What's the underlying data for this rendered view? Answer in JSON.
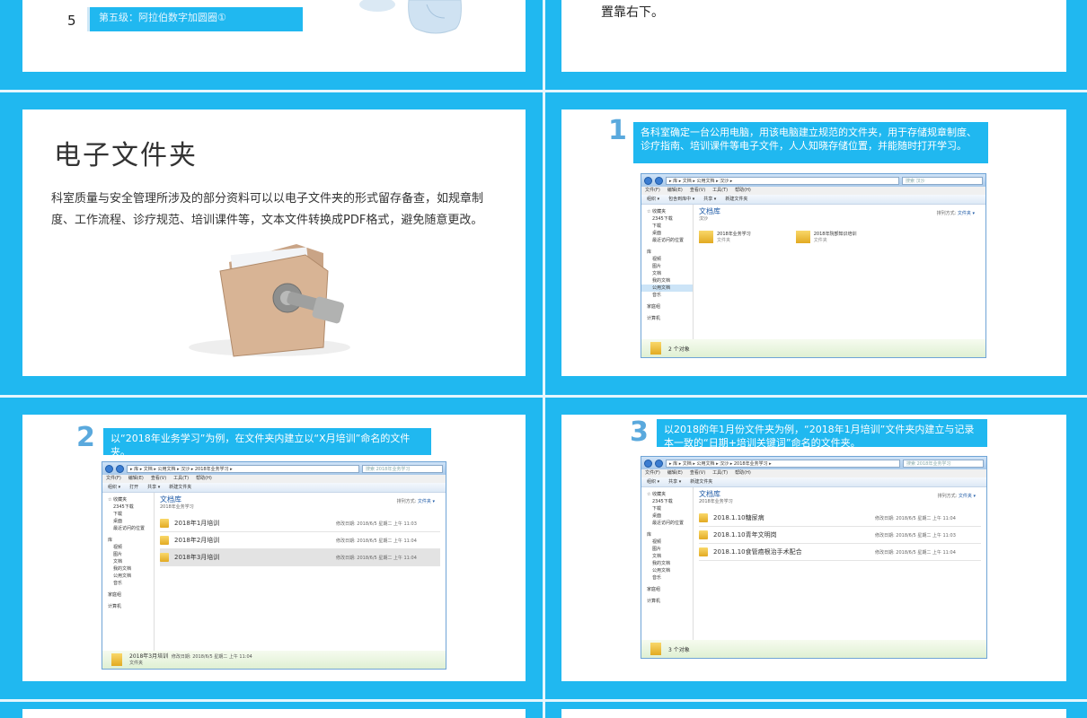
{
  "top_left": {
    "number": "5",
    "bar_text": "第五级：阿拉伯数字加圆圈①"
  },
  "top_right": {
    "text": "置靠右下。"
  },
  "slide_folder": {
    "title": "电子文件夹",
    "body": "科室质量与安全管理所涉及的部分资料可以以电子文件夹的形式留存备查，如规章制度、工作流程、诊疗规范、培训课件等，文本文件转换成PDF格式，避免随意更改。"
  },
  "step1": {
    "number": "1",
    "text": "各科室确定一台公用电脑，用该电脑建立规范的文件夹，用于存储规章制度、诊疗指南、培训课件等电子文件，人人知晓存储位置，并能随时打开学习。",
    "window": {
      "address": "▸ 库 ▸ 文档 ▸ 公用文档 ▸ 汉沙 ▸",
      "search": "搜索 汉沙",
      "menu": [
        "文件(F)",
        "编辑(E)",
        "查看(V)",
        "工具(T)",
        "帮助(H)"
      ],
      "toolbar": [
        "组织 ▾",
        "包含到库中 ▾",
        "共享 ▾",
        "新建文件夹"
      ],
      "nav": [
        "☆ 收藏夹",
        "2345下载",
        "下载",
        "桌面",
        "最近访问的位置",
        "",
        "库",
        "视频",
        "图片",
        "文档",
        "我的文档",
        "公用文档",
        "音乐",
        "",
        "家庭组",
        "",
        "计算机"
      ],
      "lib_title": "文档库",
      "lib_sub": "汉沙",
      "arrange": "排列方式:",
      "arrange_val": "文件夹 ▾",
      "tiles": [
        {
          "name": "2018年业务学习",
          "type": "文件夹"
        },
        {
          "name": "2018年院部知识培训",
          "type": "文件夹"
        }
      ],
      "status": "2 个对象"
    }
  },
  "step2": {
    "number": "2",
    "text": "以“2018年业务学习”为例，在文件夹内建立以“X月培训”命名的文件夹。",
    "window": {
      "address": "▸ 库 ▸ 文档 ▸ 公用文档 ▸ 汉沙 ▸ 2018年业务学习 ▸",
      "search": "搜索 2018年业务学习",
      "menu": [
        "文件(F)",
        "编辑(E)",
        "查看(V)",
        "工具(T)",
        "帮助(H)"
      ],
      "toolbar": [
        "组织 ▾",
        "打开",
        "共享 ▾",
        "新建文件夹"
      ],
      "nav": [
        "☆ 收藏夹",
        "2345下载",
        "下载",
        "桌面",
        "最近访问的位置",
        "",
        "库",
        "视频",
        "图片",
        "文档",
        "我的文档",
        "公用文档",
        "音乐",
        "",
        "家庭组",
        "",
        "计算机"
      ],
      "lib_title": "文档库",
      "lib_sub": "2018年业务学习",
      "arrange": "排列方式:",
      "arrange_val": "文件夹 ▾",
      "rows": [
        {
          "name": "2018年1月培训",
          "date": "修改日期: 2018/6/5 星期二 上午 11:03"
        },
        {
          "name": "2018年2月培训",
          "date": "修改日期: 2018/6/5 星期二 上午 11:04"
        },
        {
          "name": "2018年3月培训",
          "date": "修改日期: 2018/6/5 星期二 上午 11:04"
        }
      ],
      "status_name": "2018年3月培训",
      "status_date": "修改日期: 2018/6/5 星期二 上午 11:04",
      "status_type": "文件夹"
    }
  },
  "step3": {
    "number": "3",
    "text": "以2018的年1月份文件夹为例，“2018年1月培训”文件夹内建立与记录本一致的“日期+培训关键词”命名的文件夹。",
    "window": {
      "address": "▸ 库 ▸ 文档 ▸ 公用文档 ▸ 汉沙 ▸ 2018年业务学习 ▸",
      "search": "搜索 2018年业务学习",
      "menu": [
        "文件(F)",
        "编辑(E)",
        "查看(V)",
        "工具(T)",
        "帮助(H)"
      ],
      "toolbar": [
        "组织 ▾",
        "共享 ▾",
        "新建文件夹"
      ],
      "nav": [
        "☆ 收藏夹",
        "2345下载",
        "下载",
        "桌面",
        "最近访问的位置",
        "",
        "库",
        "视频",
        "图片",
        "文档",
        "我的文档",
        "公用文档",
        "音乐",
        "",
        "家庭组",
        "",
        "计算机"
      ],
      "lib_title": "文档库",
      "lib_sub": "2018年业务学习",
      "arrange": "排列方式:",
      "arrange_val": "文件夹 ▾",
      "rows": [
        {
          "name": "2018.1.10糖尿病",
          "date": "修改日期: 2018/6/5 星期二 上午 11:04"
        },
        {
          "name": "2018.1.10青年文明岗",
          "date": "修改日期: 2018/6/5 星期二 上午 11:03"
        },
        {
          "name": "2018.1.10食管癌根治手术配合",
          "date": "修改日期: 2018/6/5 星期二 上午 11:04"
        }
      ],
      "status": "3 个对象"
    }
  }
}
